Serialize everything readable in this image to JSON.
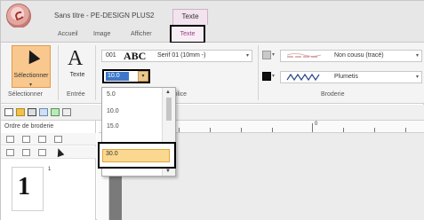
{
  "window": {
    "title": "Sans titre - PE-DESIGN PLUS2",
    "context_tab_title": "Texte"
  },
  "tabs": [
    {
      "label": "Accueil"
    },
    {
      "label": "Image"
    },
    {
      "label": "Afficher"
    },
    {
      "label": "Texte",
      "active": true
    }
  ],
  "ribbon": {
    "select": {
      "label": "Sélectionner",
      "group_label": "Sélectionner"
    },
    "text": {
      "label": "Texte",
      "group_label": "Entrée"
    },
    "font": {
      "number": "001",
      "preview": "ABC",
      "name": "Serif 01   (10mm -)"
    },
    "size": {
      "value": "10.0",
      "group_label": "Police"
    },
    "broderie": {
      "group_label": "Broderie",
      "row1": {
        "label": "Non cousu (tracé)"
      },
      "row2": {
        "label": "Plumetis"
      }
    }
  },
  "panel": {
    "title": "Ordre de broderie",
    "thumbnail_number": "1",
    "thumbnail_sup": "1"
  },
  "ruler": {
    "label0": "0"
  },
  "size_dropdown": {
    "options": [
      "5.0",
      "10.0",
      "15.0",
      "30.0"
    ],
    "highlighted": "30.0"
  },
  "colors": {
    "ribbon_bg": "#f4f4f4",
    "select_active": "#f9c88e",
    "selected_value_bg": "#3f77c8",
    "dropdown_highlight": "#fbd88f",
    "context_tab_text": "#9b3c82"
  }
}
